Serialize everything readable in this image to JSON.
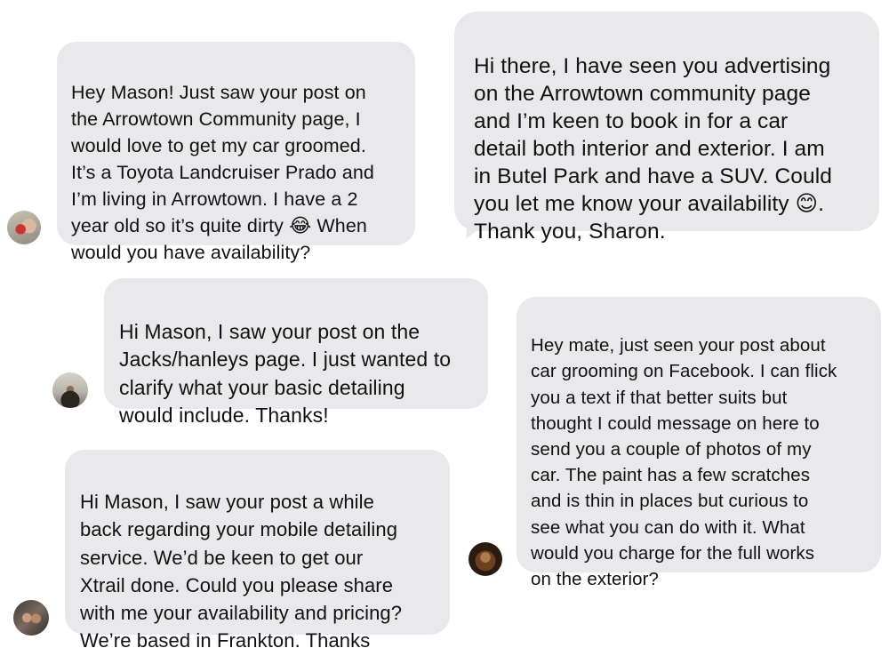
{
  "messages": [
    {
      "text": "Hey Mason! Just saw your post on\nthe Arrowtown Community page, I\nwould love to get my car groomed.\nIt’s a Toyota Landcruiser Prado and\nI’m living in Arrowtown. I have a 2\nyear old so it’s quite dirty 😂 When\nwould you have availability?"
    },
    {
      "text": "Hi there, I have seen you advertising\non the Arrowtown community page\nand I’m keen to book in for a car\ndetail both interior and exterior. I am\nin Butel Park and have a SUV. Could\nyou let me know your availability 😊.\nThank you, Sharon."
    },
    {
      "text": "Hi Mason, I saw your post on the\nJacks/hanleys page. I just wanted to\nclarify what your basic detailing\nwould include. Thanks!"
    },
    {
      "text": "Hey mate, just seen your post about\ncar grooming on Facebook. I can flick\nyou a text if that better suits but\nthought I could message on here to\nsend you a couple of photos of my\ncar. The paint has a few scratches\nand is thin in places but curious to\nsee what you can do with it. What\nwould you charge for the full works\non the exterior?"
    },
    {
      "text": "Hi Mason, I saw your post a while\nback regarding your mobile detailing\nservice. We’d be keen to get our\nXtrail done. Could you please share\nwith me your availability and pricing?\nWe’re based in Frankton. Thanks"
    }
  ]
}
